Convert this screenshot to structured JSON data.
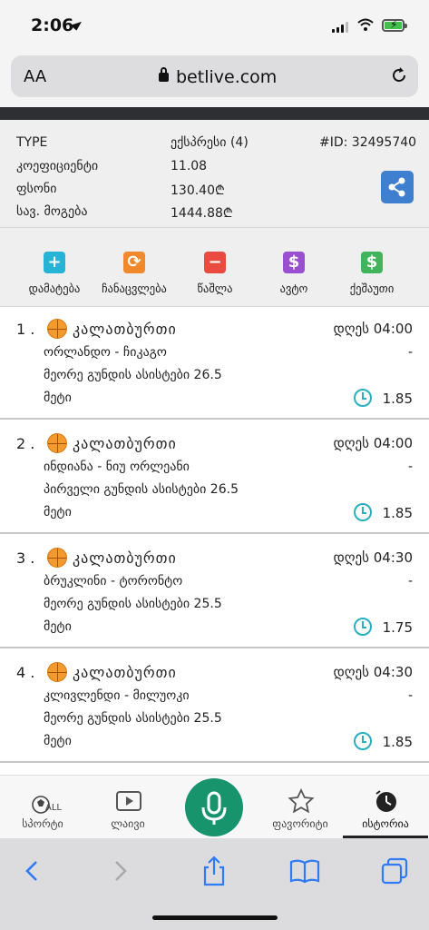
{
  "status_bar": {
    "time": "2:06"
  },
  "browser": {
    "text_size_label": "AA",
    "url": "betlive.com"
  },
  "ticket": {
    "type_label": "TYPE",
    "type_value": "ექსპრესი (4)",
    "id_label": "#ID: 32495740",
    "odds_label": "კოეფიციენტი",
    "odds_value": "11.08",
    "stake_label": "ფსონი",
    "stake_value": "130.40₾",
    "payout_label": "სავ. მოგება",
    "payout_value": "1444.88₾"
  },
  "actions": [
    {
      "label": "დამატება",
      "color": "#27b3d6",
      "glyph": "+"
    },
    {
      "label": "ჩანაცვლება",
      "color": "#f0892c",
      "glyph": "⟳"
    },
    {
      "label": "წაშლა",
      "color": "#ea4b40",
      "glyph": "−"
    },
    {
      "label": "ავტო",
      "color": "#9a4fd1",
      "glyph": "$"
    },
    {
      "label": "ქეშაუთი",
      "color": "#3fb45a",
      "glyph": "$"
    }
  ],
  "bets": [
    {
      "num": "1 .",
      "sport": "კალათბურთი",
      "date": "დღეს 04:00",
      "teams": "ორლანდო - ჩიკაგო",
      "dash": "-",
      "market": "მეორე გუნდის ასისტები 26.5",
      "pick": "მეტი",
      "odd": "1.85"
    },
    {
      "num": "2 .",
      "sport": "კალათბურთი",
      "date": "დღეს 04:00",
      "teams": "ინდიანა - ნიუ ორლეანი",
      "dash": "-",
      "market": "პირველი გუნდის ასისტები 26.5",
      "pick": "მეტი",
      "odd": "1.85"
    },
    {
      "num": "3 .",
      "sport": "კალათბურთი",
      "date": "დღეს 04:30",
      "teams": "ბრუკლინი - ტორონტო",
      "dash": "-",
      "market": "მეორე გუნდის ასისტები 25.5",
      "pick": "მეტი",
      "odd": "1.75"
    },
    {
      "num": "4 .",
      "sport": "კალათბურთი",
      "date": "დღეს 04:30",
      "teams": "კლივლენდი - მილუოკი",
      "dash": "-",
      "market": "მეორე გუნდის ასისტები 25.5",
      "pick": "მეტი",
      "odd": "1.85"
    }
  ],
  "bottom_nav": {
    "sports": "სპორტი",
    "sports_badge": "ALL",
    "live": "ლაივი",
    "favorites": "ფავორიტი",
    "history": "ისტორია"
  }
}
